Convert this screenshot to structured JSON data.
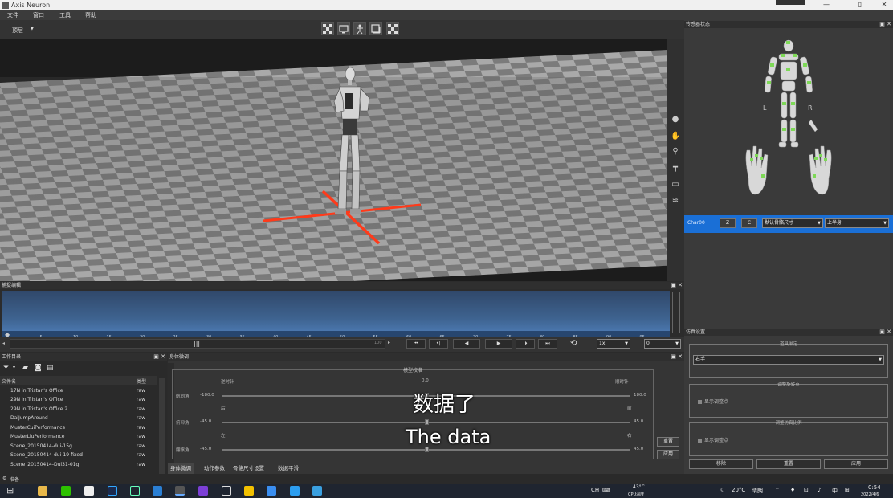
{
  "window": {
    "title": "Axis Neuron",
    "controls": [
      "—",
      "▯",
      "✕"
    ]
  },
  "menu": [
    "文件",
    "窗口",
    "工具",
    "帮助"
  ],
  "toolbar": {
    "view_label": "顶层"
  },
  "timeline": {
    "title": "捕捉编辑",
    "ticks": [
      "0",
      "5",
      "10",
      "15",
      "20",
      "25",
      "30",
      "35",
      "40",
      "45",
      "50",
      "55",
      "60",
      "65",
      "70",
      "75",
      "80",
      "85",
      "90",
      "95"
    ],
    "start": "0",
    "end": "100",
    "speed": "1x",
    "frame": "0"
  },
  "sensor": {
    "title": "传感器状态",
    "left": "L",
    "right": "R"
  },
  "actor": {
    "name": "Char00",
    "btn_z": "Z",
    "btn_c": "C",
    "size": "默认骨骼尺寸",
    "mode": "上半身"
  },
  "files": {
    "title": "工作目录",
    "col_name": "文件名",
    "col_type": "类型",
    "rows": [
      {
        "name": "17N in Tristan's Office",
        "type": "raw"
      },
      {
        "name": "29N in Tristan's Office",
        "type": "raw"
      },
      {
        "name": "29N in Tristan's Office 2",
        "type": "raw"
      },
      {
        "name": "DaiJumpAround",
        "type": "raw"
      },
      {
        "name": "MusterCuiPerformance",
        "type": "raw"
      },
      {
        "name": "MusterLiuPerformance",
        "type": "raw"
      },
      {
        "name": "Scene_20150414-dui-15g",
        "type": "raw"
      },
      {
        "name": "Scene_20150414-dui-19-fixed",
        "type": "raw"
      },
      {
        "name": "Scene_20150414-Dui31-01g",
        "type": "raw"
      }
    ]
  },
  "body_adj": {
    "title": "身体微调",
    "group": "模型校准",
    "rows": [
      {
        "label": "航向角:",
        "min": "-180.0",
        "max": "180.0",
        "left": "逆时针",
        "center": "0.0",
        "right": "顺时针",
        "value": 0.5
      },
      {
        "label": "俯仰角:",
        "min": "-45.0",
        "max": "45.0",
        "left": "后",
        "center": "",
        "right": "前",
        "value": 0.5
      },
      {
        "label": "翻滚角:",
        "min": "-45.0",
        "max": "45.0",
        "left": "左",
        "center": "",
        "right": "右",
        "value": 0.5
      }
    ],
    "reset": "重置",
    "apply": "应用",
    "tabs": [
      "身体微调",
      "动作参数",
      "骨骼尺寸设置",
      "数据平滑"
    ]
  },
  "sim": {
    "title": "仿真设置",
    "g1": "道具绑定",
    "hand": "右手",
    "g2": "调整旋转点",
    "chk1": "显示调整点",
    "g3": "调整仿真比例",
    "chk2": "显示调整点",
    "b1": "移除",
    "b2": "重置",
    "b3": "应用"
  },
  "status": "准备",
  "subtitles": {
    "zh": "数据了",
    "en": "The data"
  },
  "taskbar": {
    "temp": "20°C",
    "weather": "晴朗",
    "cpu_temp": "43°C",
    "cpu_label": "CPU温度",
    "ime1": "中",
    "time": "0:54",
    "date": "2022/4/6",
    "ime2": "CH"
  },
  "colors": {
    "accent": "#1a6fd6",
    "floor_marker": "#ff3a1a",
    "sensor_ok": "#7ed957"
  }
}
